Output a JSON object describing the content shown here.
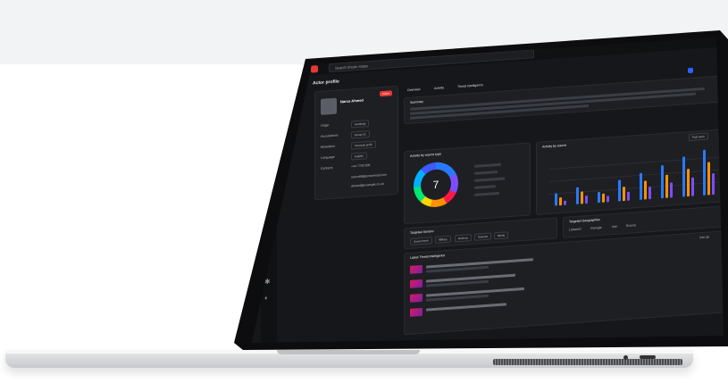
{
  "app": {
    "search_placeholder": "Search Shodo status",
    "page_title": "Actor profile"
  },
  "profile": {
    "name": "Narco Ahmed",
    "status_badge": "Active",
    "fields": [
      {
        "label": "Origin",
        "value": "Hamburg"
      },
      {
        "label": "Associations",
        "value": "Group 52"
      },
      {
        "label": "Motivation",
        "value": "Financial profit"
      },
      {
        "label": "Language",
        "value": "English"
      },
      {
        "label": "Contacts",
        "value": "+44 7700 900"
      }
    ],
    "emails": [
      "narco88@protonmail.com",
      "ahmed@example.co.uk"
    ]
  },
  "tabs": [
    "Overview",
    "Activity",
    "Threat Intelligence"
  ],
  "summary_title": "Summary",
  "chart_sections": {
    "donut_title": "Activity by source type",
    "donut_center": "7",
    "bars_title": "Activity by source",
    "bars_filter": "Past week"
  },
  "chart_data": {
    "type": "bar",
    "series": [
      {
        "values": [
          8,
          11,
          7,
          14,
          17,
          21,
          26,
          29
        ]
      },
      {
        "values": [
          5,
          8,
          6,
          9,
          12,
          15,
          18,
          21
        ]
      },
      {
        "values": [
          3,
          5,
          4,
          6,
          8,
          10,
          12,
          14
        ]
      }
    ],
    "ylim": [
      0,
      32
    ],
    "grid": true,
    "colors": [
      "#2979ff",
      "#ff9100",
      "#7c4dff"
    ]
  },
  "sections": {
    "targeted_sectors": "Targeted Sectors",
    "targeted_geographies": "Targeted Geographies",
    "latest_intel": "Latest Threat Intelligence",
    "see_all": "See all"
  },
  "sector_chips": [
    "Government",
    "Military",
    "Defence",
    "Telecom",
    "Media"
  ],
  "geo_chips": [
    "Lebanon",
    "Georgia",
    "Iran",
    "Russia"
  ],
  "colors": {
    "accent": "#e53935",
    "primary": "#2962ff",
    "background": "#16171a"
  }
}
